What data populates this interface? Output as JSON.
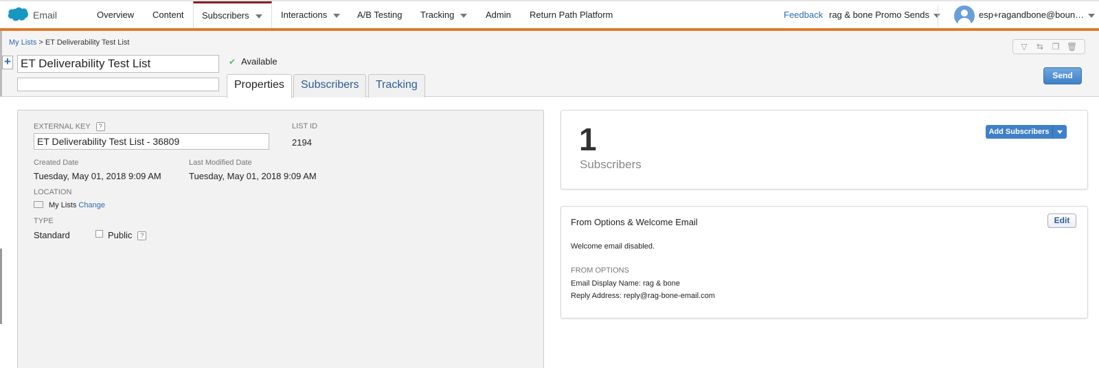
{
  "app": {
    "name": "Email"
  },
  "nav": {
    "overview": "Overview",
    "content": "Content",
    "subscribers": "Subscribers",
    "interactions": "Interactions",
    "ab_testing": "A/B Testing",
    "tracking": "Tracking",
    "admin": "Admin",
    "return_path": "Return Path Platform",
    "feedback": "Feedback",
    "account": "rag & bone Promo Sends",
    "user": "esp+ragandbone@boun…"
  },
  "breadcrumb": {
    "root": "My Lists",
    "separator": ">",
    "current": "ET Deliverability Test List"
  },
  "list": {
    "name": "ET Deliverability Test List",
    "description": "",
    "status": "Available"
  },
  "tabs": {
    "properties": "Properties",
    "subscribers": "Subscribers",
    "tracking": "Tracking"
  },
  "actions": {
    "send": "Send"
  },
  "properties": {
    "external_key_label": "EXTERNAL KEY",
    "external_key": "ET Deliverability Test List - 36809",
    "list_id_label": "LIST ID",
    "list_id": "2194",
    "created_label": "Created Date",
    "created": "Tuesday, May 01, 2018 9:09 AM",
    "modified_label": "Last Modified Date",
    "modified": "Tuesday, May 01, 2018 9:09 AM",
    "location_label": "LOCATION",
    "location": "My Lists",
    "change_label": "Change",
    "type_label": "TYPE",
    "type": "Standard",
    "public_label": "Public",
    "help": "?"
  },
  "subscribers_card": {
    "count": "1",
    "label": "Subscribers",
    "add_button": "Add Subscribers"
  },
  "from_options_card": {
    "title": "From Options & Welcome Email",
    "edit": "Edit",
    "welcome": "Welcome email disabled.",
    "from_label": "FROM OPTIONS",
    "display_name": "Email Display Name: rag & bone",
    "reply_address": "Reply Address: reply@rag-bone-email.com"
  },
  "colors": {
    "accent_orange": "#e07a2c",
    "link_blue": "#2b6cb0",
    "active_tab_top": "#8a1b1b"
  },
  "icons": [
    "salesforce-cloud-icon",
    "filter-icon",
    "move-icon",
    "copy-icon",
    "trash-icon",
    "check-icon",
    "plus-icon",
    "folder-icon",
    "user-avatar-icon"
  ]
}
